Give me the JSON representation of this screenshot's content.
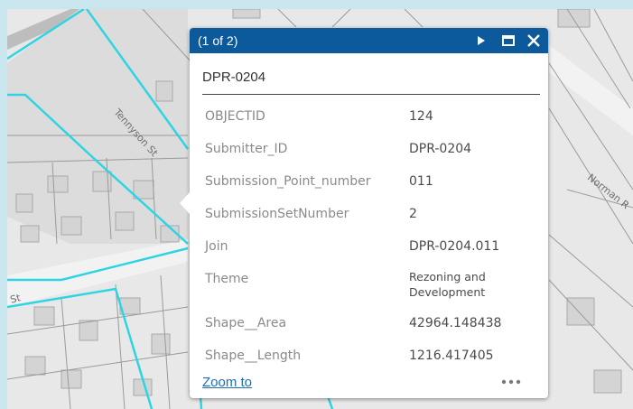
{
  "map": {
    "street_labels": [
      "Tennyson St",
      "Norman R",
      "St"
    ]
  },
  "popup": {
    "counter": "(1 of 2)",
    "title": "DPR-0204",
    "icons": {
      "next": "play-next-icon",
      "dock": "maximize-icon",
      "close": "close-icon",
      "more": "ellipsis-icon"
    },
    "attributes": [
      {
        "key": "OBJECTID",
        "value": "124"
      },
      {
        "key": "Submitter_ID",
        "value": "DPR-0204"
      },
      {
        "key": "Submission_Point_number",
        "value": "011"
      },
      {
        "key": "SubmissionSetNumber",
        "value": "2"
      },
      {
        "key": "Join",
        "value": "DPR-0204.011"
      },
      {
        "key": "Theme",
        "value": "Rezoning and Development"
      },
      {
        "key": "Shape__Area",
        "value": "42964.148438"
      },
      {
        "key": "Shape__Length",
        "value": "1216.417405"
      }
    ],
    "zoom_label": "Zoom to"
  },
  "colors": {
    "header": "#0c5a9b",
    "parcel_outline": "#2fd4e3",
    "map_background": "#e9e9e9",
    "building": "#d7d7d7",
    "frame": "#c9e6ee"
  }
}
